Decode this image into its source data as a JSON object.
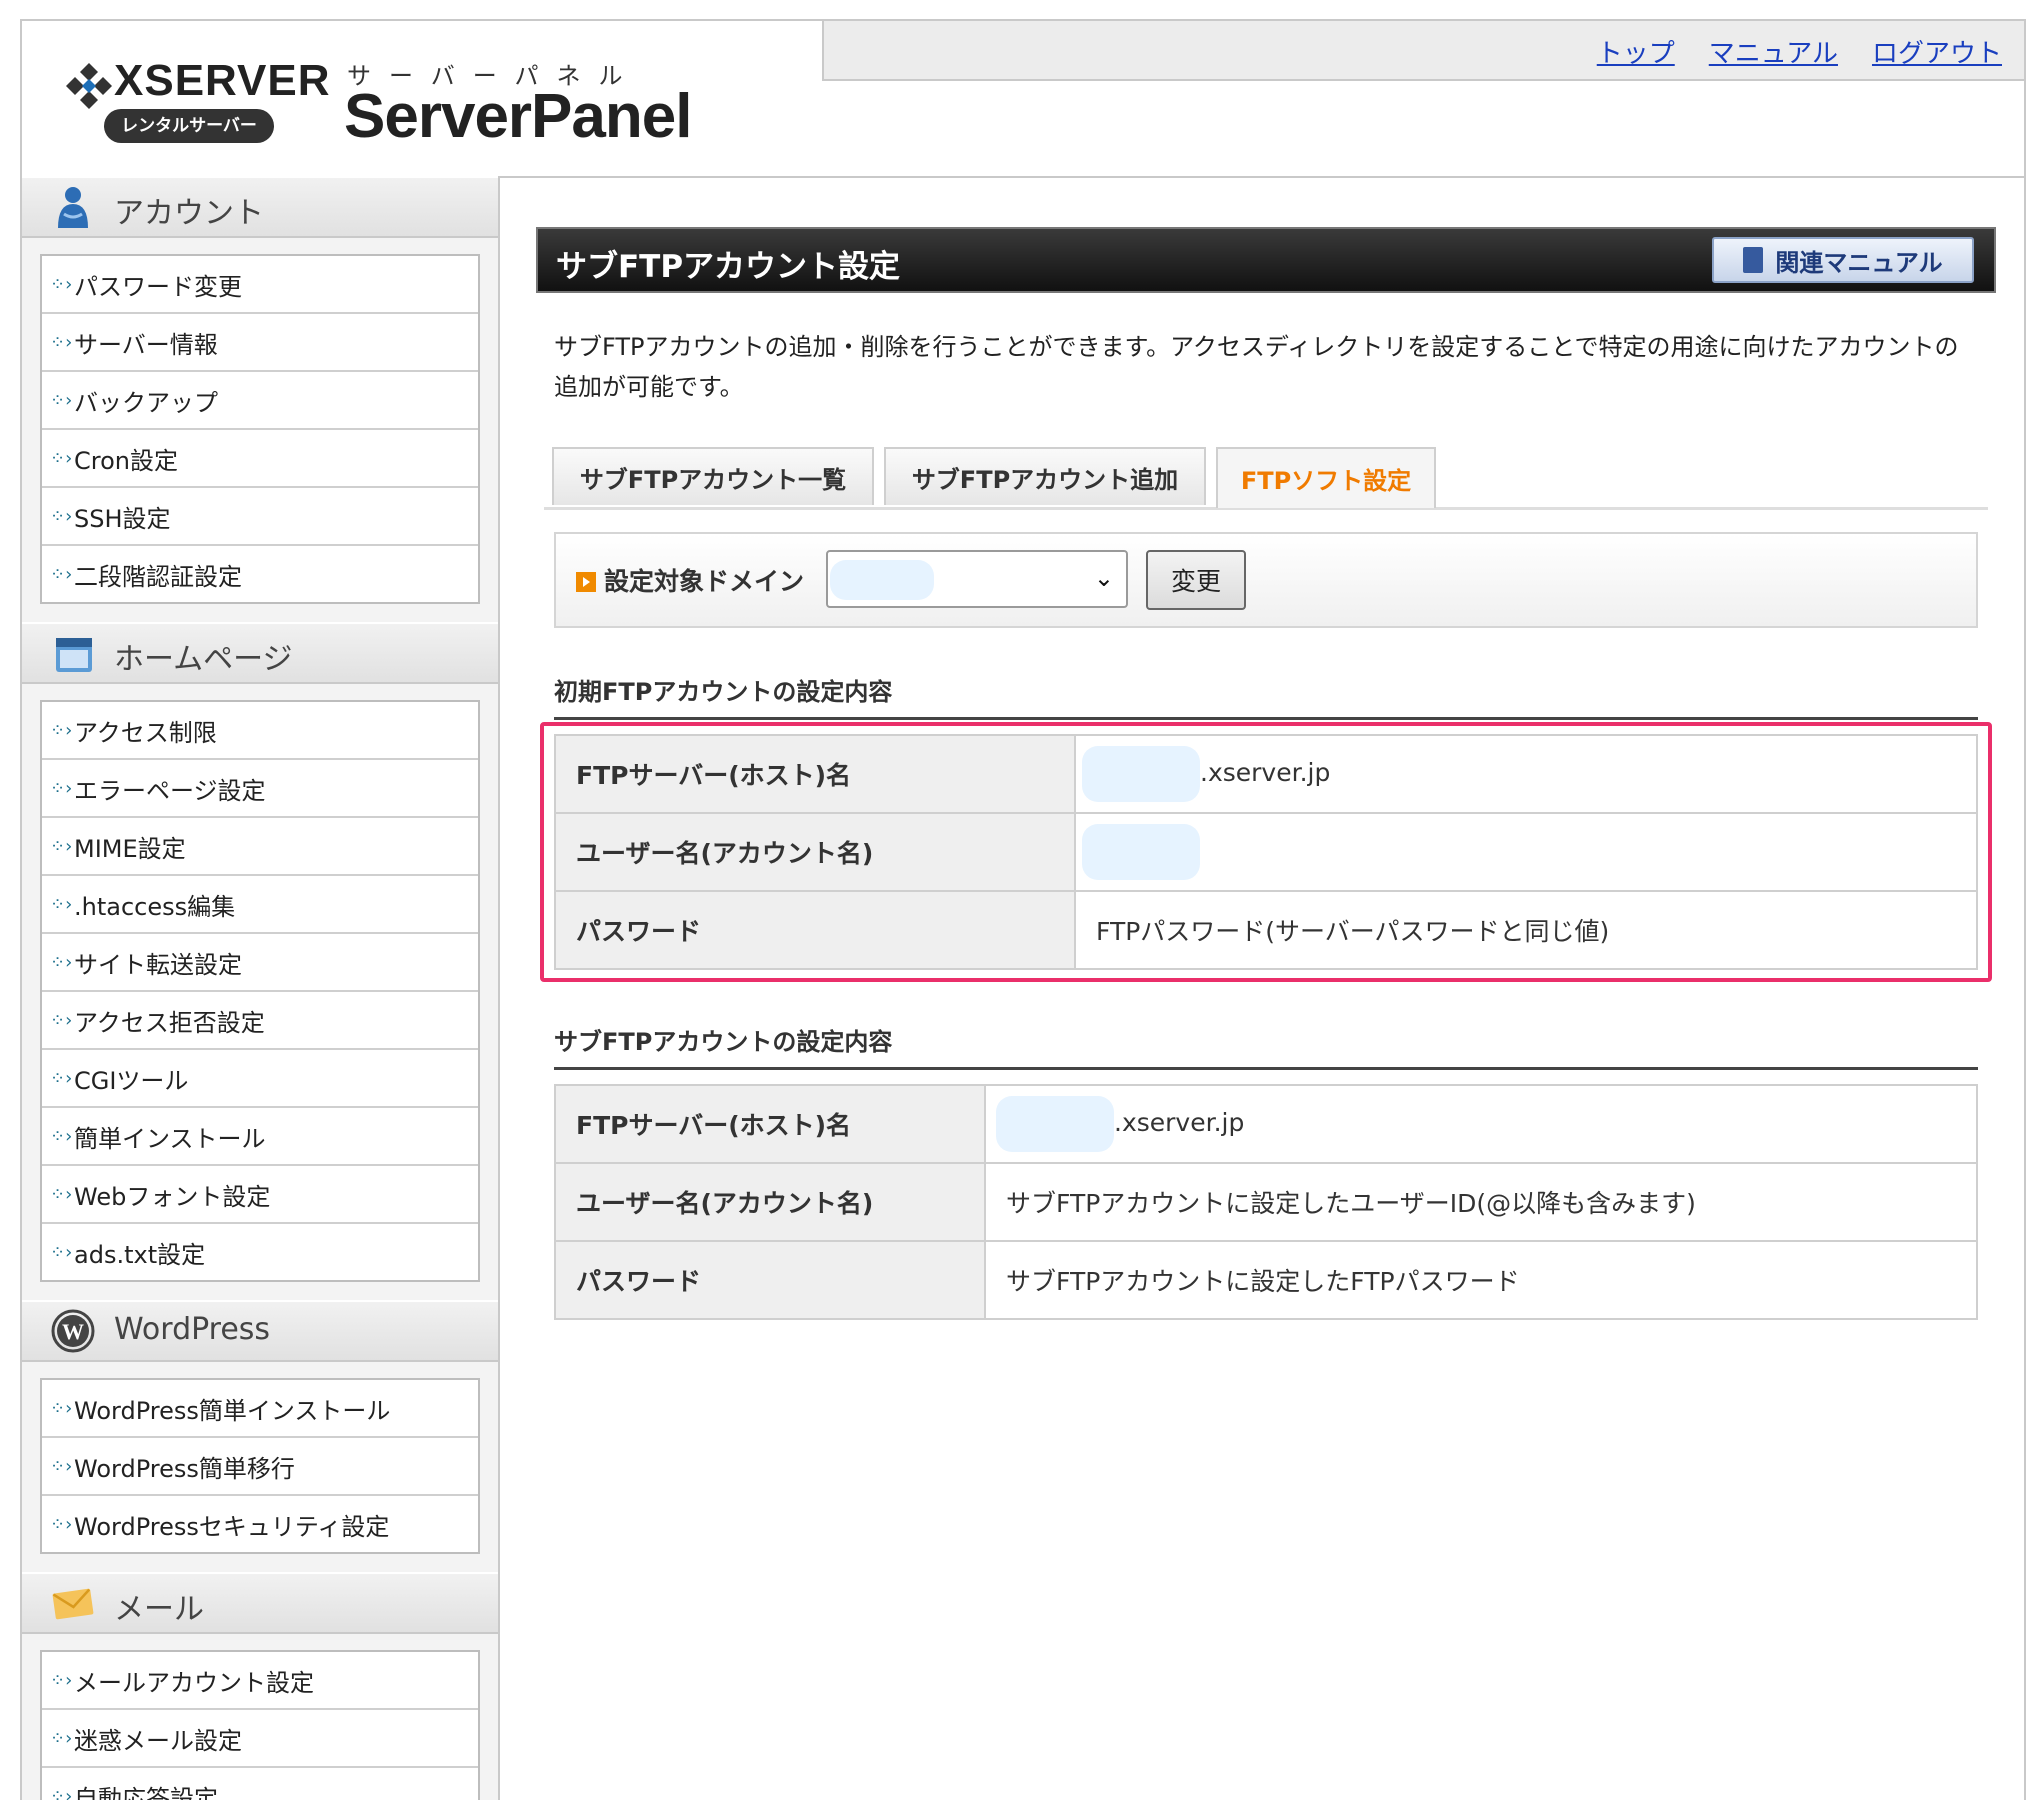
{
  "header": {
    "brand": "XSERVER",
    "badge": "レンタルサーバー",
    "kana": "サーバーパネル",
    "product": "ServerPanel",
    "nav": [
      "トップ",
      "マニュアル",
      "ログアウト"
    ]
  },
  "sidebar": {
    "sections": [
      {
        "title": "アカウント",
        "icon": "user-icon",
        "items": [
          "パスワード変更",
          "サーバー情報",
          "バックアップ",
          "Cron設定",
          "SSH設定",
          "二段階認証設定"
        ]
      },
      {
        "title": "ホームページ",
        "icon": "homepage-icon",
        "items": [
          "アクセス制限",
          "エラーページ設定",
          "MIME設定",
          ".htaccess編集",
          "サイト転送設定",
          "アクセス拒否設定",
          "CGIツール",
          "簡単インストール",
          "Webフォント設定",
          "ads.txt設定"
        ]
      },
      {
        "title": "WordPress",
        "icon": "wordpress-icon",
        "items": [
          "WordPress簡単インストール",
          "WordPress簡単移行",
          "WordPressセキュリティ設定"
        ]
      },
      {
        "title": "メール",
        "icon": "mail-icon",
        "items": [
          "メールアカウント設定",
          "迷惑メール設定",
          "自動応答設定"
        ]
      }
    ]
  },
  "main": {
    "title": "サブFTPアカウント設定",
    "manual_button": "関連マニュアル",
    "intro": "サブFTPアカウントの追加・削除を行うことができます。アクセスディレクトリを設定することで特定の用途に向けたアカウントの追加が可能です。",
    "tabs": [
      "サブFTPアカウント一覧",
      "サブFTPアカウント追加",
      "FTPソフト設定"
    ],
    "active_tab": "FTPソフト設定",
    "domain": {
      "label": "設定対象ドメイン",
      "button": "変更"
    },
    "initial": {
      "heading": "初期FTPアカウントの設定内容",
      "rows": [
        {
          "label": "FTPサーバー(ホスト)名",
          "value": ".xserver.jp"
        },
        {
          "label": "ユーザー名(アカウント名)",
          "value": ""
        },
        {
          "label": "パスワード",
          "value": "FTPパスワード(サーバーパスワードと同じ値)"
        }
      ]
    },
    "sub": {
      "heading": "サブFTPアカウントの設定内容",
      "rows": [
        {
          "label": "FTPサーバー(ホスト)名",
          "value": ".xserver.jp"
        },
        {
          "label": "ユーザー名(アカウント名)",
          "value": "サブFTPアカウントに設定したユーザーID(@以降も含みます)"
        },
        {
          "label": "パスワード",
          "value": "サブFTPアカウントに設定したFTPパスワード"
        }
      ]
    }
  },
  "colors": {
    "highlight": "#ea2f6a",
    "active_tab": "#f07b00",
    "link": "#1a3fbf"
  }
}
